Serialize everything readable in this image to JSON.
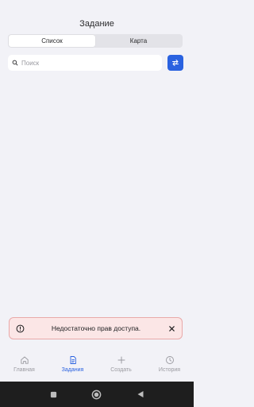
{
  "header": {
    "title": "Задание"
  },
  "segmented": {
    "options": [
      {
        "label": "Список",
        "active": true
      },
      {
        "label": "Карта",
        "active": false
      }
    ]
  },
  "search": {
    "placeholder": "Поиск",
    "value": ""
  },
  "filter_button": {
    "icon": "swap-icon"
  },
  "toast": {
    "icon": "alert-circle-icon",
    "message": "Недостаточно прав доступа.",
    "close_icon": "close-icon"
  },
  "tabbar": {
    "items": [
      {
        "label": "Главная",
        "icon": "home-icon",
        "active": false
      },
      {
        "label": "Задания",
        "icon": "document-icon",
        "active": true
      },
      {
        "label": "Создать",
        "icon": "plus-icon",
        "active": false
      },
      {
        "label": "История",
        "icon": "clock-icon",
        "active": false
      }
    ]
  },
  "colors": {
    "accent": "#2a62e0",
    "background": "#f2f2f7",
    "toast_bg": "#fbe6e6",
    "toast_border": "#e9a9a9",
    "inactive": "#9a9aa0"
  }
}
